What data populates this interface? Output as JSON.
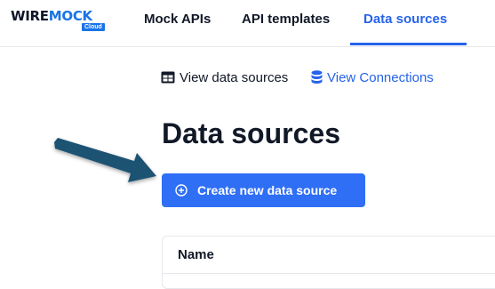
{
  "logo": {
    "word_part1": "WIRE",
    "word_part2": "MOCK",
    "badge": "Cloud"
  },
  "nav": {
    "items": [
      {
        "label": "Mock APIs",
        "active": false
      },
      {
        "label": "API templates",
        "active": false
      },
      {
        "label": "Data sources",
        "active": true
      }
    ]
  },
  "links": {
    "view_data_sources": "View data sources",
    "view_connections": "View Connections"
  },
  "page": {
    "title": "Data sources",
    "create_button_label": "Create new data source"
  },
  "table": {
    "columns": [
      "Name"
    ]
  },
  "colors": {
    "accent": "#2563eb",
    "button": "#2f6ff5",
    "annotation_arrow": "#1c5273"
  },
  "icons": {
    "view_data_sources": "table-grid-icon",
    "view_connections": "database-icon",
    "create_button": "plus-circle-icon",
    "annotation": "arrow-pointer-icon"
  }
}
